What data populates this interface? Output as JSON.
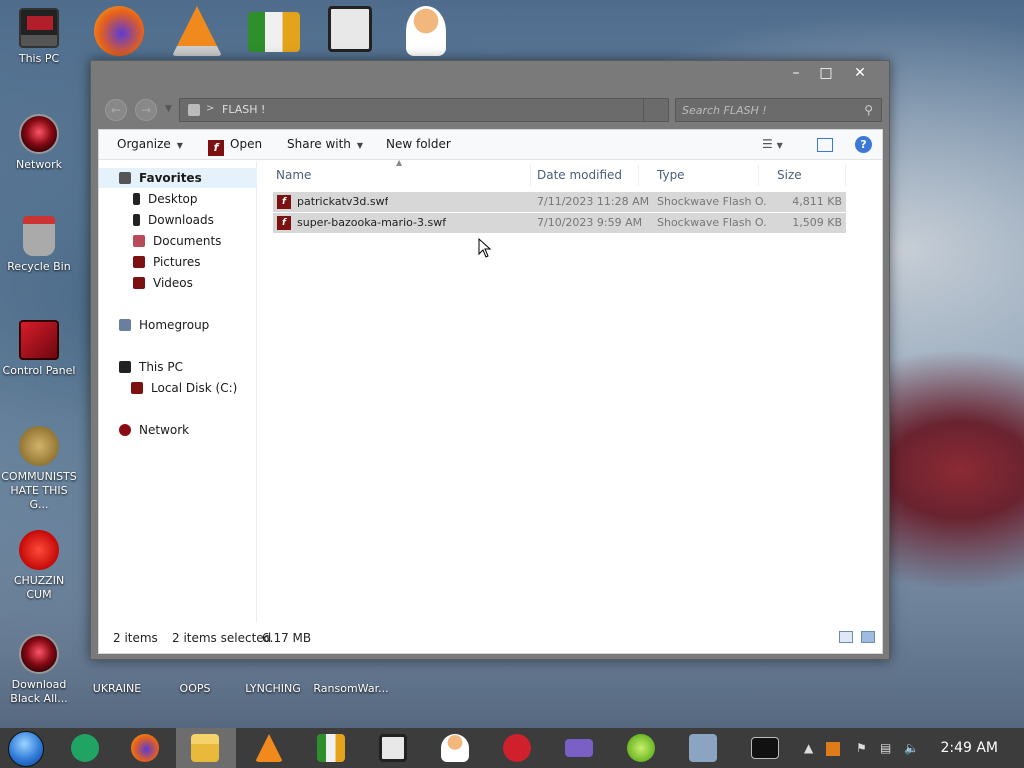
{
  "desktop": {
    "icons": [
      {
        "label": "This PC"
      },
      {
        "label": "Network"
      },
      {
        "label": "Recycle Bin"
      },
      {
        "label": "Control Panel"
      },
      {
        "label": "COMMUNISTS HATE THIS G..."
      },
      {
        "label": "CHUZZIN CUM"
      },
      {
        "label": "Download Black All..."
      },
      {
        "label": "UKRAINE"
      },
      {
        "label": "OOPS"
      },
      {
        "label": "LYNCHING"
      },
      {
        "label": "RansomWar..."
      }
    ]
  },
  "window": {
    "address": {
      "path": "FLASH !",
      "separator": ">"
    },
    "search": {
      "placeholder": "Search FLASH !"
    },
    "toolbar": {
      "organize": "Organize",
      "open": "Open",
      "share_with": "Share with",
      "new_folder": "New folder"
    },
    "nav": {
      "favorites": "Favorites",
      "desktop": "Desktop",
      "downloads": "Downloads",
      "documents": "Documents",
      "pictures": "Pictures",
      "videos": "Videos",
      "homegroup": "Homegroup",
      "this_pc": "This PC",
      "local_disk": "Local Disk (C:)",
      "network": "Network"
    },
    "columns": {
      "name": "Name",
      "date": "Date modified",
      "type": "Type",
      "size": "Size"
    },
    "files": [
      {
        "name": "patrickatv3d.swf",
        "date": "7/11/2023 11:28 AM",
        "type": "Shockwave Flash O...",
        "size": "4,811 KB"
      },
      {
        "name": "super-bazooka-mario-3.swf",
        "date": "7/10/2023 9:59 AM",
        "type": "Shockwave Flash O...",
        "size": "1,509 KB"
      }
    ],
    "status": {
      "count": "2 items",
      "selected": "2 items selected",
      "size": "6.17 MB"
    }
  },
  "taskbar": {
    "clock": "2:49 AM"
  },
  "colors": {
    "window_frame": "#7a7a7a",
    "selection": "#d7d7d7",
    "flash_icon": "#7b1111",
    "taskbar": "#3c3c3c"
  }
}
